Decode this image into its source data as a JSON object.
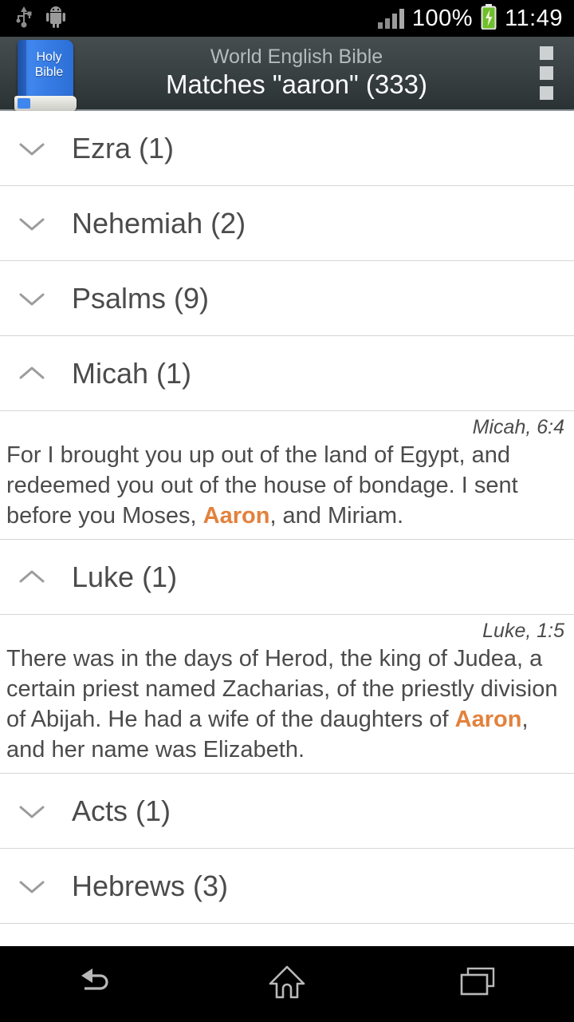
{
  "statusbar": {
    "icons": [
      "usb-icon",
      "android-icon",
      "signal-icon"
    ],
    "battery_percent": "100%",
    "battery_icon": "battery-charging-icon",
    "time": "11:49"
  },
  "actionbar": {
    "app_icon_line1": "Holy",
    "app_icon_line2": "Bible",
    "subtitle": "World English Bible",
    "title": "Matches \"aaron\"  (333)",
    "overflow_label": "overflow-menu"
  },
  "colors": {
    "highlight": "#e3813c",
    "text": "#4b4b4b",
    "divider": "#d6d6d6",
    "actionbar_top": "#454d4f",
    "actionbar_bottom": "#2b3234"
  },
  "results": [
    {
      "book": "Ezra (1)",
      "expanded": false,
      "verses": []
    },
    {
      "book": "Nehemiah (2)",
      "expanded": false,
      "verses": []
    },
    {
      "book": "Psalms (9)",
      "expanded": false,
      "verses": []
    },
    {
      "book": "Micah (1)",
      "expanded": true,
      "verses": [
        {
          "ref": "Micah, 6:4",
          "before": "For I brought you up out of the land of Egypt, and redeemed you out of the house of bondage. I sent before you Moses, ",
          "match": "Aaron",
          "after": ", and Miriam."
        }
      ]
    },
    {
      "book": "Luke (1)",
      "expanded": true,
      "verses": [
        {
          "ref": "Luke, 1:5",
          "before": "There was in the days of Herod, the king of Judea, a certain priest named Zacharias, of the priestly division of Abijah. He had a wife of the daughters of ",
          "match": "Aaron",
          "after": ", and her name was Elizabeth."
        }
      ]
    },
    {
      "book": "Acts (1)",
      "expanded": false,
      "verses": []
    },
    {
      "book": "Hebrews (3)",
      "expanded": false,
      "verses": []
    }
  ],
  "navbar": {
    "back_label": "back-button",
    "home_label": "home-button",
    "recents_label": "recent-apps-button"
  }
}
